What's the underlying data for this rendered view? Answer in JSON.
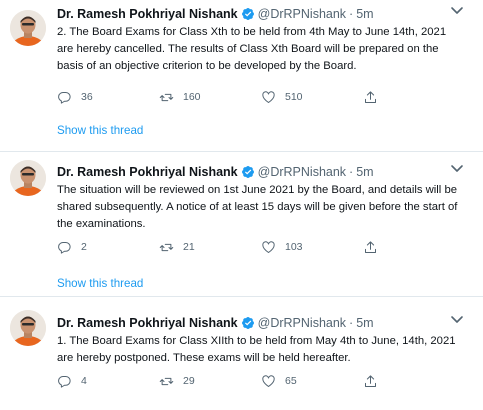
{
  "tweets": [
    {
      "author": "Dr. Ramesh Pokhriyal Nishank",
      "handle": "@DrRPNishank",
      "separator": "·",
      "time": "5m",
      "text": "2.  The Board Exams for Class Xth to be held from 4th May  to June 14th, 2021 are hereby cancelled. The results of Class Xth Board will be prepared on the basis of an objective criterion to be developed by the Board.",
      "replies": "36",
      "retweets": "160",
      "likes": "510",
      "thread_link": "Show this thread"
    },
    {
      "author": "Dr. Ramesh Pokhriyal Nishank",
      "handle": "@DrRPNishank",
      "separator": "·",
      "time": "5m",
      "text": "The situation will be reviewed on 1st June 2021 by the Board, and details will be shared subsequently. A notice of at least 15 days will be given before the start of the examinations.",
      "replies": "2",
      "retweets": "21",
      "likes": "103",
      "thread_link": "Show this thread"
    },
    {
      "author": "Dr. Ramesh Pokhriyal Nishank",
      "handle": "@DrRPNishank",
      "separator": "·",
      "time": "5m",
      "text": "1.  The Board Exams for Class XIIth to be held from May 4th to June, 14th, 2021 are hereby postponed. These exams will be held hereafter.",
      "replies": "4",
      "retweets": "29",
      "likes": "65"
    }
  ],
  "colors": {
    "link": "#1d9bf0",
    "verified": "#1d9bf0",
    "muted": "#536471",
    "divider": "#e1e8ed"
  },
  "icons": [
    "verified-badge-icon",
    "chevron-down-icon",
    "reply-icon",
    "retweet-icon",
    "like-icon",
    "share-icon"
  ]
}
